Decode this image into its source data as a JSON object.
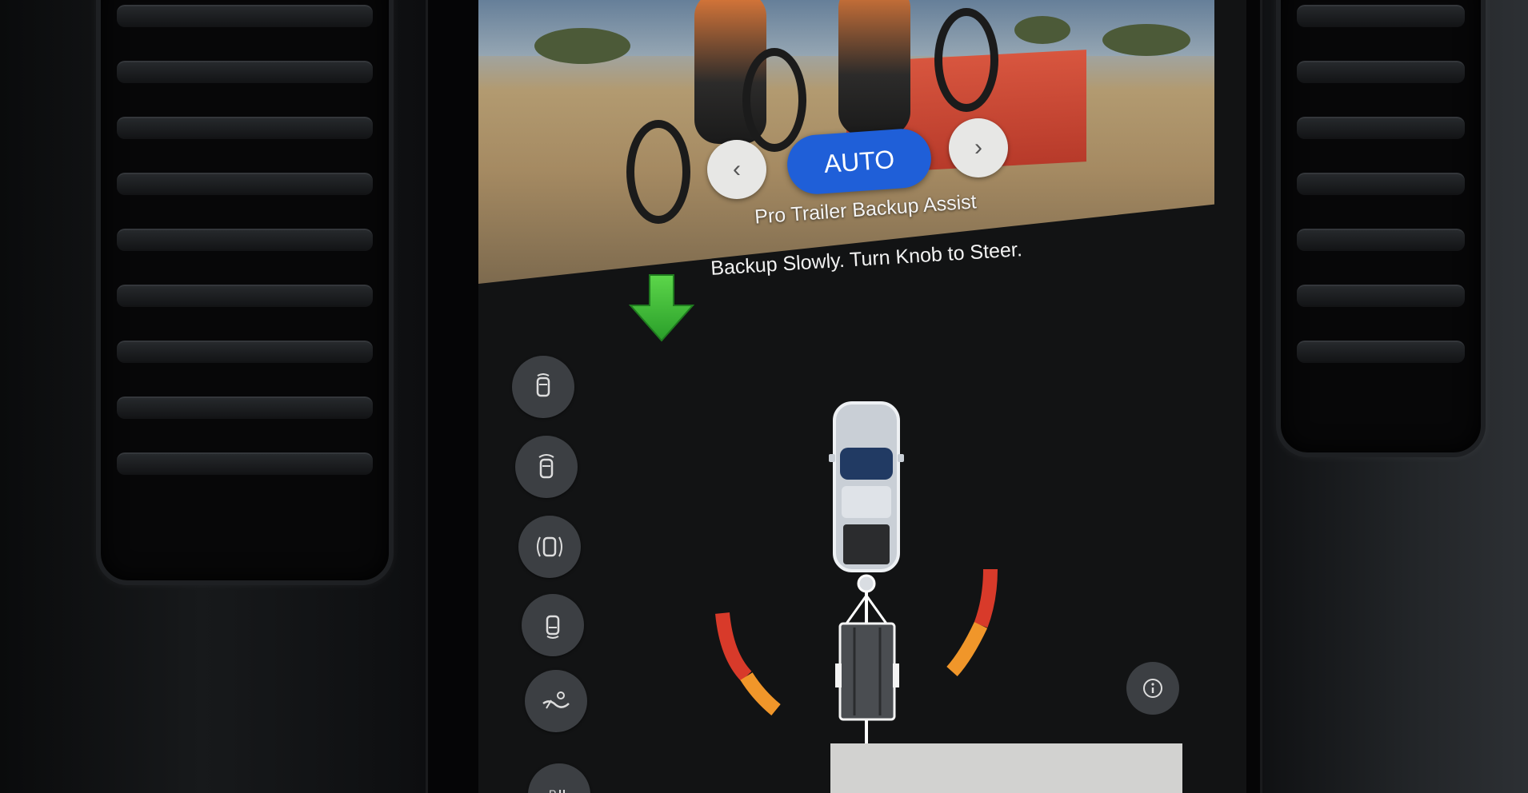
{
  "camera": {
    "mode_button_label": "AUTO",
    "title": "Pro Trailer Backup Assist",
    "prev_icon": "chevron-left-icon",
    "next_icon": "chevron-right-icon"
  },
  "instruction": {
    "text": "Backup Slowly. Turn Knob to Steer.",
    "arrow_color": "#3fbf3a"
  },
  "side_buttons": [
    {
      "icon": "front-camera-icon"
    },
    {
      "icon": "front-sensors-icon"
    },
    {
      "icon": "surround-view-icon"
    },
    {
      "icon": "rear-camera-icon"
    },
    {
      "icon": "trailer-hitch-icon"
    },
    {
      "icon": "parking-icon"
    }
  ],
  "guidance": {
    "left_arc_colors": [
      "#d83a2a",
      "#f0962a"
    ],
    "right_arc_colors": [
      "#d83a2a",
      "#f0962a"
    ]
  },
  "info_icon": "info-icon",
  "colors": {
    "accent": "#1f5fd8",
    "screen_bg": "#121314",
    "button_bg": "#3c3f43"
  }
}
